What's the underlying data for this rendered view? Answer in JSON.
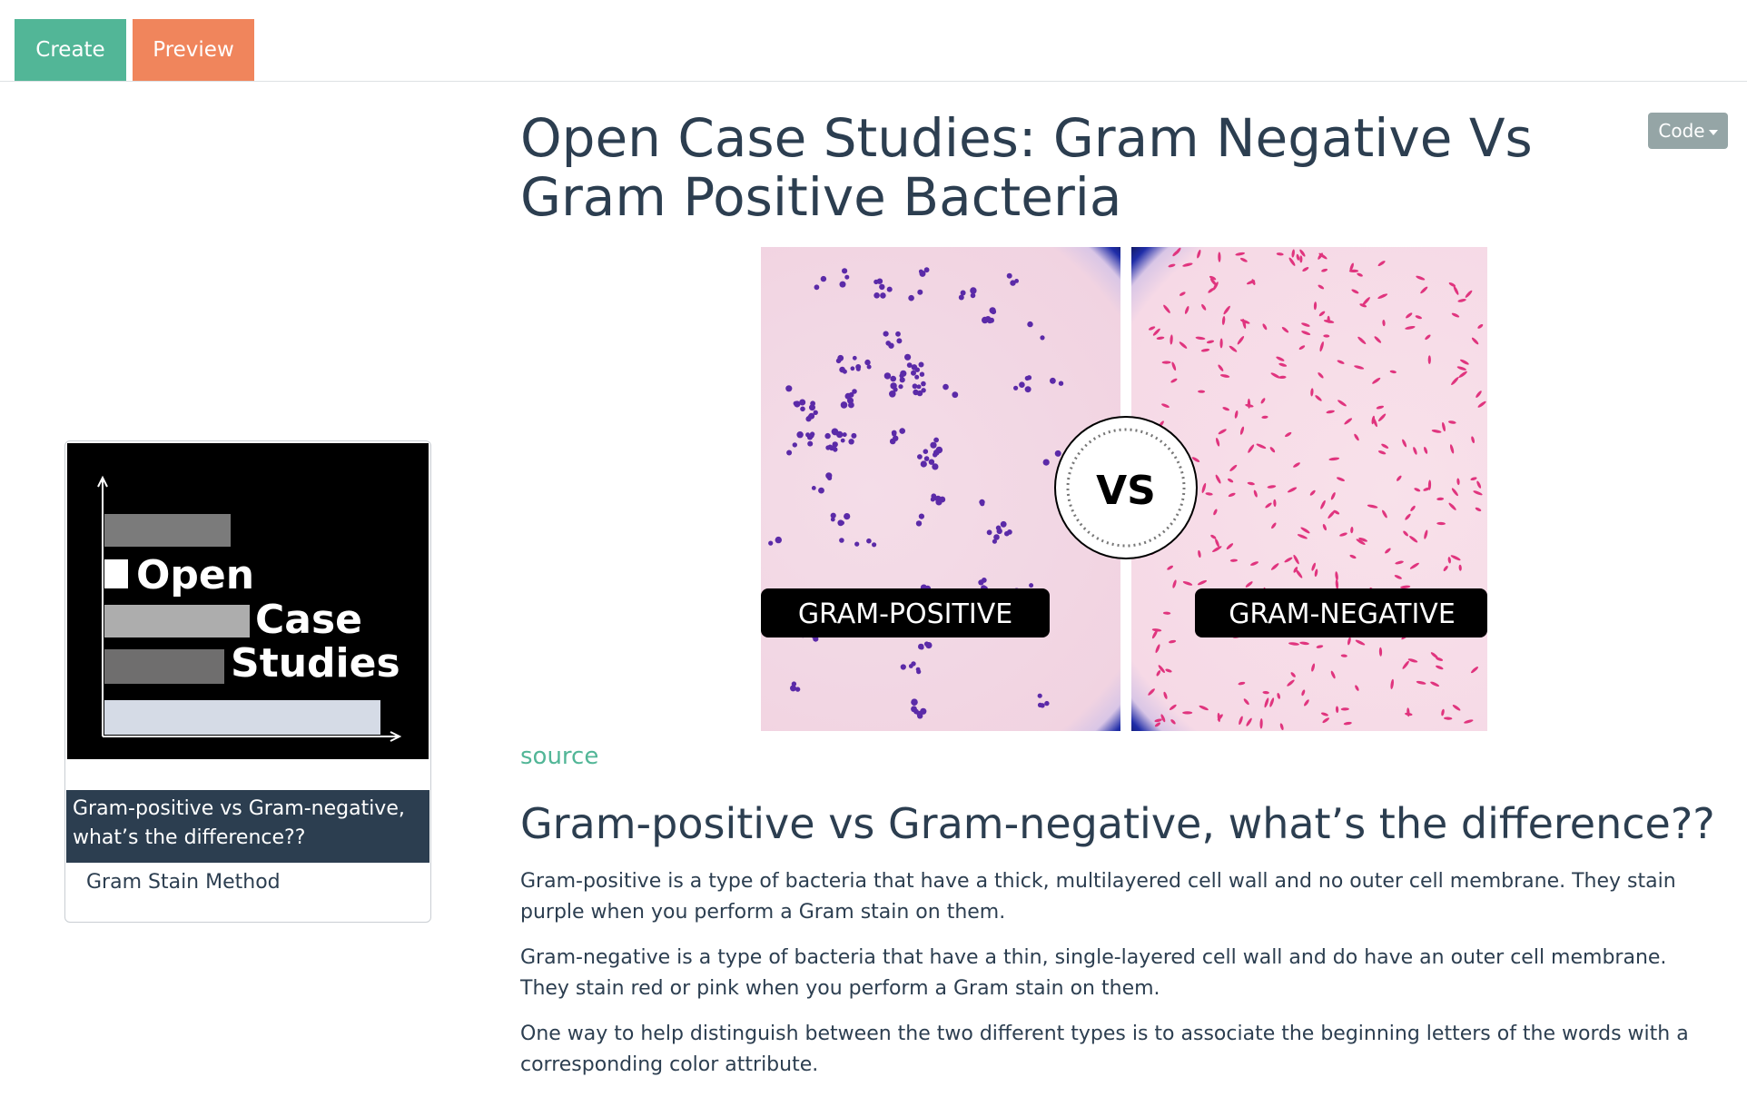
{
  "tabs": {
    "create_label": "Create",
    "preview_label": "Preview"
  },
  "code_button": {
    "label": "Code"
  },
  "toc": {
    "logo": {
      "line1": "Open",
      "line2": "Case",
      "line3": "Studies"
    },
    "items": [
      {
        "label": "Gram-positive vs Gram-negative, what’s the difference??",
        "active": true
      },
      {
        "label": "Gram Stain Method",
        "active": false
      }
    ]
  },
  "main": {
    "title": "Open Case Studies: Gram Negative Vs Gram Positive Bacteria",
    "hero": {
      "left_label": "GRAM-POSITIVE",
      "right_label": "GRAM-NEGATIVE",
      "vs_label": "VS"
    },
    "source_link": "source",
    "section_title": "Gram-positive vs Gram-negative, what’s the difference??",
    "paragraphs": [
      "Gram-positive is a type of bacteria that have a thick, multilayered cell wall and no outer cell membrane. They stain purple when you perform a Gram stain on them.",
      "Gram-negative is a type of bacteria that have a thin, single-layered cell wall and do have an outer cell membrane. They stain red or pink when you perform a Gram stain on them.",
      "One way to help distinguish between the two different types is to associate the beginning letters of the words with a corresponding color attribute."
    ]
  },
  "colors": {
    "create_tab": "#52b697",
    "preview_tab": "#f0855c",
    "text": "#2c3e50",
    "accent": "#52b697",
    "code_button": "#95a5a6",
    "gram_positive": "#5b2aa8",
    "gram_negative": "#e0347e"
  }
}
